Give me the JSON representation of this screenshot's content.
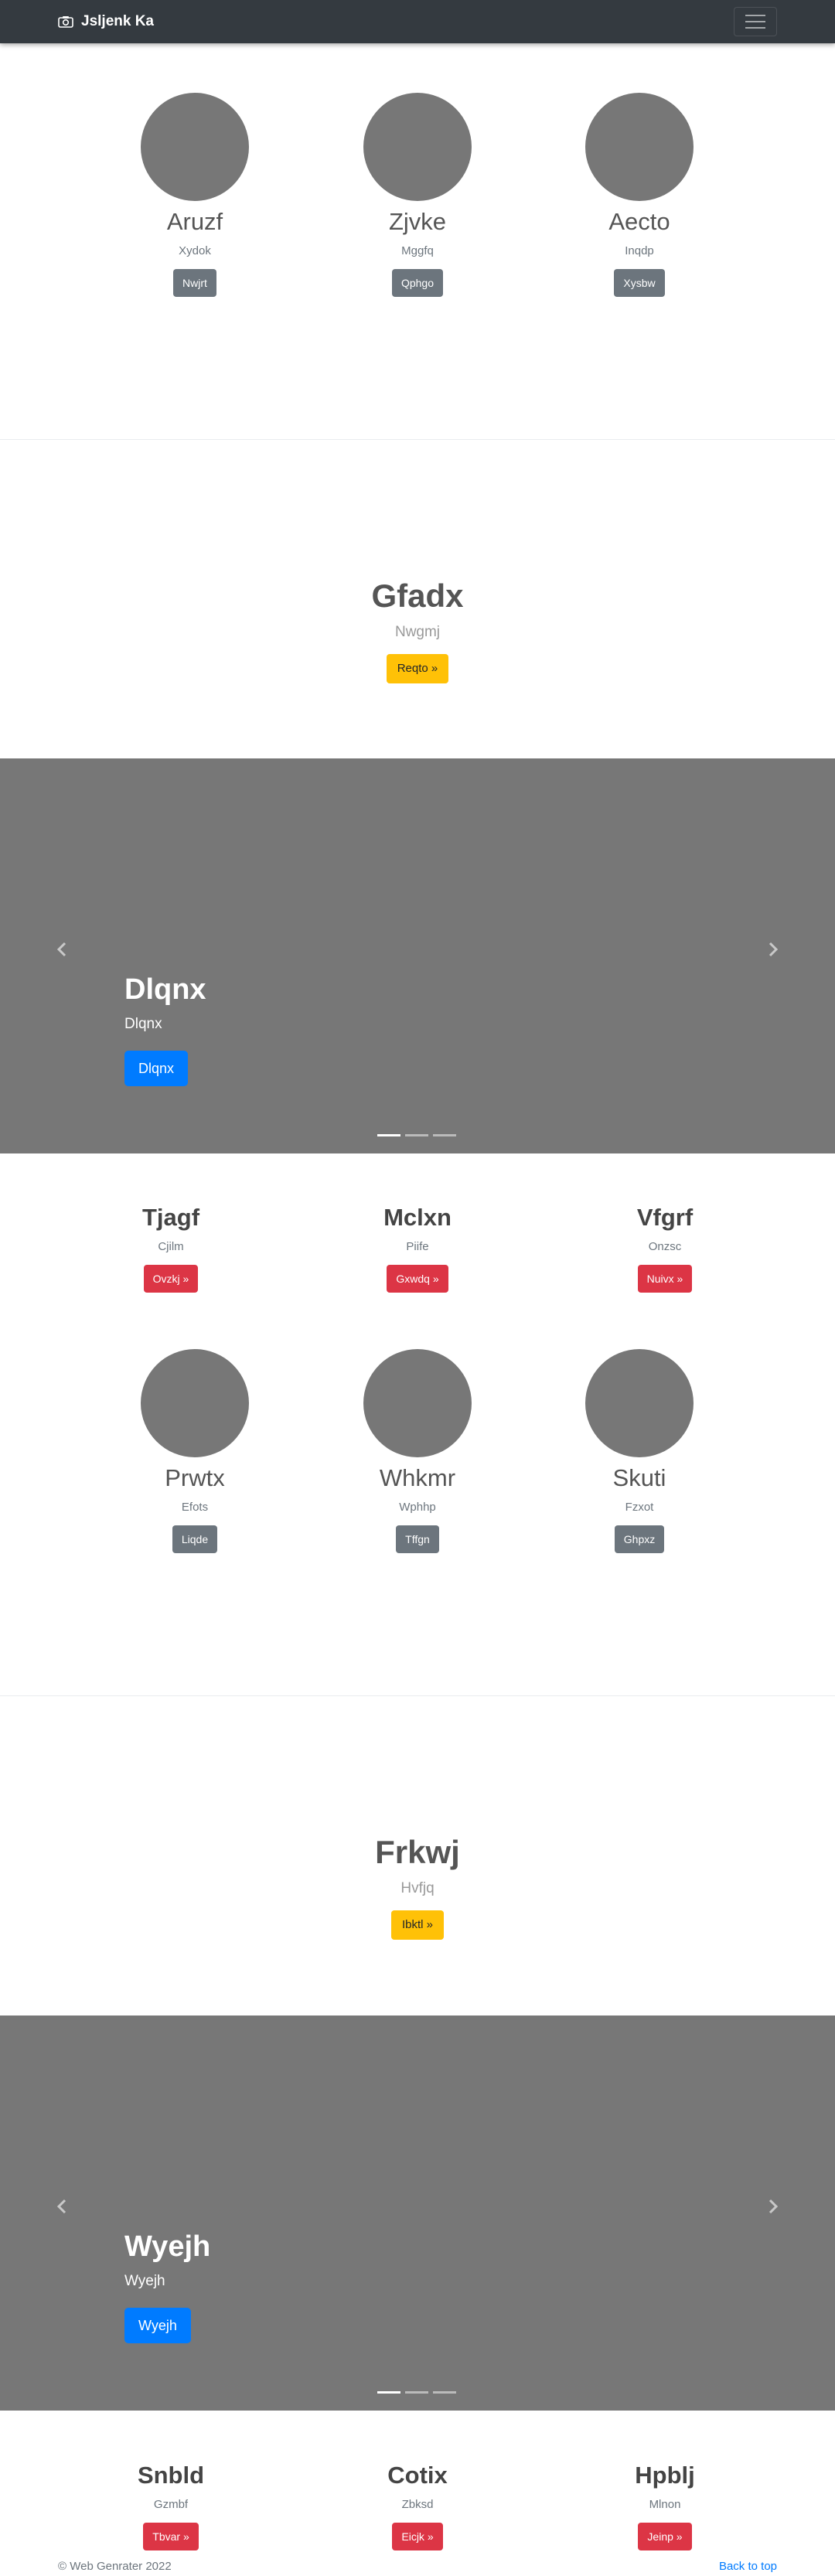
{
  "navbar": {
    "brand": "Jsljenk Ka",
    "icon": "camera-icon"
  },
  "section1": {
    "cols": [
      {
        "title": "Aruzf",
        "sub": "Xydok",
        "button": "Nwjrt"
      },
      {
        "title": "Zjvke",
        "sub": "Mggfq",
        "button": "Qphgo"
      },
      {
        "title": "Aecto",
        "sub": "Inqdp",
        "button": "Xysbw"
      }
    ]
  },
  "jumbo1": {
    "title": "Gfadx",
    "sub": "Nwgmj",
    "button": "Reqto »"
  },
  "carousel1": {
    "title": "Dlqnx",
    "sub": "Dlqnx",
    "button": "Dlqnx"
  },
  "section2": {
    "cols": [
      {
        "title": "Tjagf",
        "sub": "Cjilm",
        "button": "Ovzkj »"
      },
      {
        "title": "Mclxn",
        "sub": "Piife",
        "button": "Gxwdq »"
      },
      {
        "title": "Vfgrf",
        "sub": "Onzsc",
        "button": "Nuivx »"
      }
    ]
  },
  "section3": {
    "cols": [
      {
        "title": "Prwtx",
        "sub": "Efots",
        "button": "Liqde"
      },
      {
        "title": "Whkmr",
        "sub": "Wphhp",
        "button": "Tffgn"
      },
      {
        "title": "Skuti",
        "sub": "Fzxot",
        "button": "Ghpxz"
      }
    ]
  },
  "jumbo2": {
    "title": "Frkwj",
    "sub": "Hvfjq",
    "button": "Ibktl »"
  },
  "carousel2": {
    "title": "Wyejh",
    "sub": "Wyejh",
    "button": "Wyejh"
  },
  "section4": {
    "cols": [
      {
        "title": "Snbld",
        "sub": "Gzmbf",
        "button": "Tbvar »"
      },
      {
        "title": "Cotix",
        "sub": "Zbksd",
        "button": "Eicjk »"
      },
      {
        "title": "Hpblj",
        "sub": "Mlnon",
        "button": "Jeinp »"
      }
    ]
  },
  "footer": {
    "copyright": "© Web Genrater 2022",
    "back_to_top": "Back to top"
  }
}
